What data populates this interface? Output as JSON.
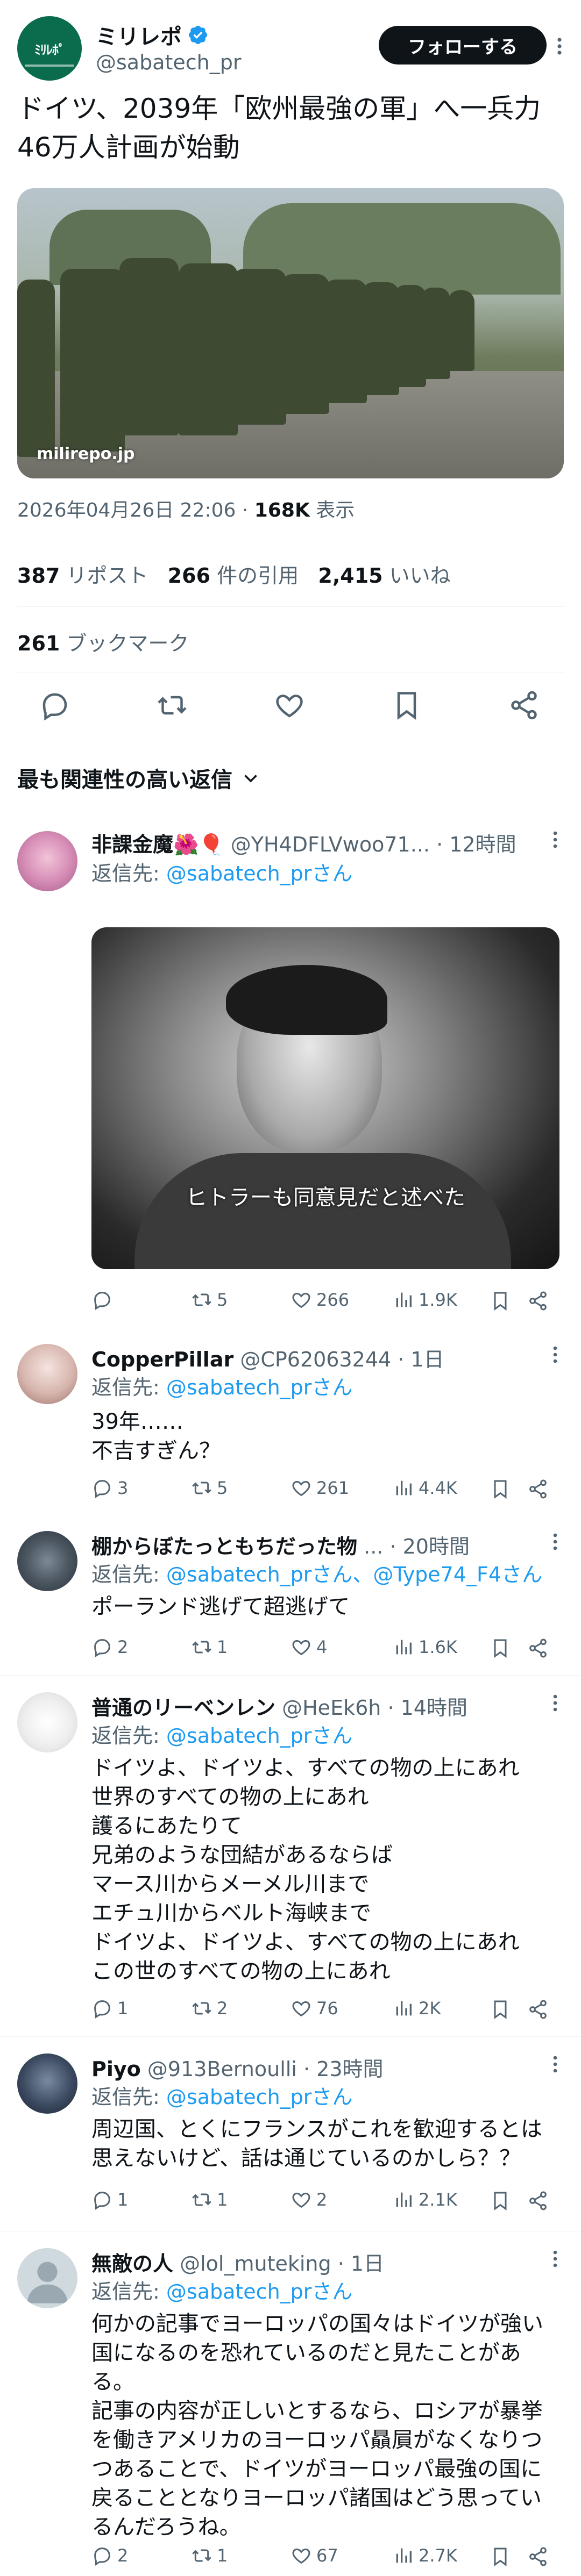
{
  "tweet": {
    "author_name": "ミリレポ",
    "author_handle": "@sabatech_pr",
    "avatar_logo": "ﾐﾘﾚﾎﾟ",
    "follow_label": "フォローする",
    "text": "ドイツ、2039年「欧州最強の軍」へ一兵力46万人計画が始動",
    "image_watermark": "milirepo.jp",
    "timestamp": "2026年04月26日 22:06",
    "separator": "·",
    "views_count": "168K",
    "views_label": "表示",
    "reposts_count": "387",
    "reposts_label": "リポスト",
    "quotes_count": "266",
    "quotes_label": "件の引用",
    "likes_count": "2,415",
    "likes_label": "いいね",
    "bookmarks_count": "261",
    "bookmarks_label": "ブックマーク"
  },
  "replies_sort_label": "最も関連性の高い返信",
  "replies": [
    {
      "name": "非課金魔🌺🎈",
      "handle": "@YH4DFLVwoo71...",
      "time": "· 12時間",
      "replyto_prefix": "返信先:",
      "replyto_link": "@sabatech_prさん",
      "body": "",
      "image_caption": "ヒトラーも同意見だと述べた",
      "metrics": {
        "replies": "",
        "reposts": "5",
        "likes": "266",
        "views": "1.9K"
      }
    },
    {
      "name": "CopperPillar",
      "handle": "@CP62063244",
      "time": "· 1日",
      "replyto_prefix": "返信先:",
      "replyto_link": "@sabatech_prさん",
      "body": "39年……\n不吉すぎん？",
      "metrics": {
        "replies": "3",
        "reposts": "5",
        "likes": "261",
        "views": "4.4K"
      }
    },
    {
      "name": "棚からぼたっともちだった物",
      "handle": "...",
      "time": "· 20時間",
      "replyto_prefix": "返信先:",
      "replyto_link": "@sabatech_prさん、@Type74_F4さん",
      "body": "ポーランド逃げて超逃げて",
      "metrics": {
        "replies": "2",
        "reposts": "1",
        "likes": "4",
        "views": "1.6K"
      }
    },
    {
      "name": "普通のリーベンレン",
      "handle": "@HeEk6h",
      "time": "· 14時間",
      "replyto_prefix": "返信先:",
      "replyto_link": "@sabatech_prさん",
      "body": "ドイツよ、ドイツよ、すべての物の上にあれ\n世界のすべての物の上にあれ\n護るにあたりて\n兄弟のような団結があるならば\nマース川からメーメル川まで\nエチュ川からベルト海峡まで\nドイツよ、ドイツよ、すべての物の上にあれ\nこの世のすべての物の上にあれ",
      "metrics": {
        "replies": "1",
        "reposts": "2",
        "likes": "76",
        "views": "2K"
      }
    },
    {
      "name": "Piyo",
      "handle": "@913Bernoulli",
      "time": "· 23時間",
      "replyto_prefix": "返信先:",
      "replyto_link": "@sabatech_prさん",
      "body": "周辺国、とくにフランスがこれを歓迎するとは\n思えないけど、話は通じているのかしら？？",
      "metrics": {
        "replies": "1",
        "reposts": "1",
        "likes": "2",
        "views": "2.1K"
      }
    },
    {
      "name": "無敵の人",
      "handle": "@lol_muteking",
      "time": "· 1日",
      "replyto_prefix": "返信先:",
      "replyto_link": "@sabatech_prさん",
      "body": "何かの記事でヨーロッパの国々はドイツが強い\n国になるのを恐れているのだと見たことがあ\nる。\n記事の内容が正しいとするなら、ロシアが暴挙\nを働きアメリカのヨーロッパ贔屓がなくなりつ\nつあることで、ドイツがヨーロッパ最強の国に\n戻ることとなりヨーロッパ諸国はどう思ってい\nるんだろうね。",
      "metrics": {
        "replies": "2",
        "reposts": "1",
        "likes": "67",
        "views": "2.7K"
      }
    }
  ],
  "colors": {
    "accent": "#1d9bf0",
    "text": "#0f1419",
    "muted": "#536471",
    "divider": "#eff3f4"
  },
  "icons": [
    "verified-icon",
    "more-icon",
    "reply-icon",
    "repost-icon",
    "like-icon",
    "bookmark-icon",
    "share-icon",
    "views-icon",
    "chevron-down-icon"
  ]
}
